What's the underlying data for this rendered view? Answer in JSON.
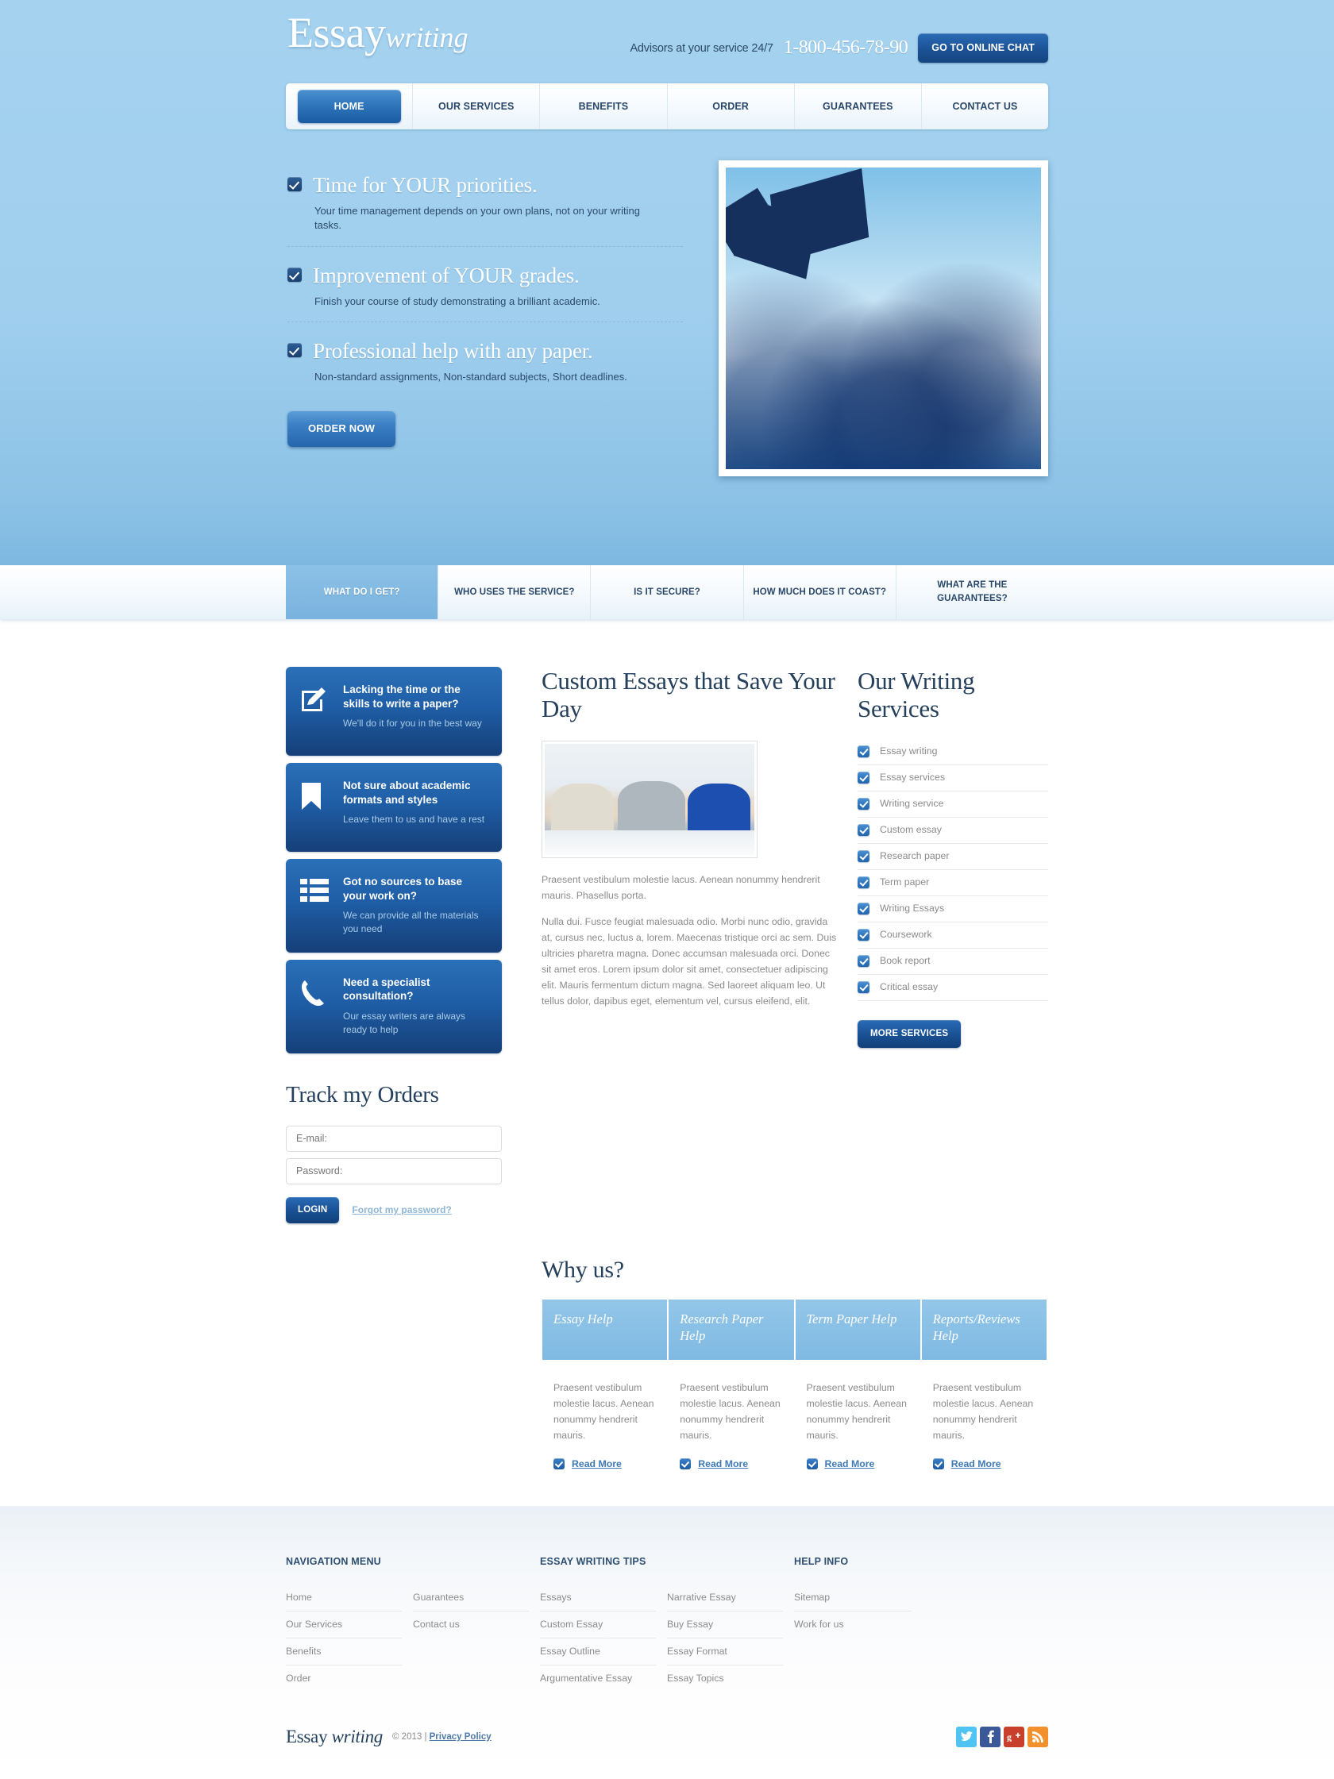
{
  "brand": {
    "name_main": "Essay",
    "name_italic": "writing"
  },
  "header": {
    "advisors_text": "Advisors at your service 24/7",
    "phone": "1-800-456-78-90",
    "chat_button": "GO TO ONLINE CHAT"
  },
  "nav": {
    "items": [
      {
        "label": "HOME",
        "active": true
      },
      {
        "label": "OUR SERVICES",
        "active": false
      },
      {
        "label": "BENEFITS",
        "active": false
      },
      {
        "label": "ORDER",
        "active": false
      },
      {
        "label": "GUARANTEES",
        "active": false
      },
      {
        "label": "CONTACT US",
        "active": false
      }
    ]
  },
  "hero": {
    "features": [
      {
        "title": "Time for YOUR priorities.",
        "desc": "Your time management depends on your own plans, not on your writing tasks."
      },
      {
        "title": "Improvement of YOUR grades.",
        "desc": "Finish your course of study demonstrating a brilliant academic."
      },
      {
        "title": "Professional help with any paper.",
        "desc": "Non-standard assignments, Non-standard subjects, Short deadlines."
      }
    ],
    "order_button": "ORDER NOW"
  },
  "question_tabs": [
    {
      "label": "WHAT DO I GET?",
      "active": true
    },
    {
      "label": "WHO USES THE SERVICE?",
      "active": false
    },
    {
      "label": "IS IT SECURE?",
      "active": false
    },
    {
      "label": "HOW MUCH DOES IT COAST?",
      "active": false
    },
    {
      "label": "WHAT ARE THE GUARANTEES?",
      "active": false
    }
  ],
  "promo_boxes": [
    {
      "icon": "pencil-square-icon",
      "title": "Lacking the time or the skills to write a paper?",
      "desc": "We'll do it for you in the best way"
    },
    {
      "icon": "bookmark-icon",
      "title": "Not sure about academic formats and styles",
      "desc": "Leave them to us and have a rest"
    },
    {
      "icon": "list-icon",
      "title": "Got no sources to base your work on?",
      "desc": "We can provide all the materials you need"
    },
    {
      "icon": "phone-icon",
      "title": "Need a specialist consultation?",
      "desc": "Our essay writers are always ready to help"
    }
  ],
  "track_orders": {
    "heading": "Track my Orders",
    "email_placeholder": "E-mail:",
    "email_value": "",
    "password_placeholder": "Password:",
    "password_value": "",
    "login_button": "LOGIN",
    "forgot_link": "Forgot my password?"
  },
  "main_article": {
    "heading": "Custom Essays that Save Your Day",
    "paragraphs": [
      "Praesent vestibulum molestie lacus. Aenean nonummy hendrerit mauris. Phasellus porta.",
      "Nulla dui. Fusce feugiat malesuada odio. Morbi nunc odio, gravida at, cursus nec, luctus a, lorem. Maecenas tristique orci ac sem. Duis ultricies pharetra magna. Donec accumsan malesuada orci. Donec sit amet eros. Lorem ipsum dolor sit amet, consectetuer adipiscing elit. Mauris fermentum dictum magna. Sed laoreet aliquam leo. Ut tellus dolor, dapibus eget, elementum vel, cursus eleifend, elit."
    ]
  },
  "services": {
    "heading": "Our Writing Services",
    "items": [
      "Essay writing",
      "Essay services",
      "Writing service",
      "Custom essay",
      "Research paper",
      "Term paper",
      "Writing Essays",
      "Coursework",
      "Book report",
      "Critical essay"
    ],
    "more_button": "MORE SERVICES"
  },
  "why_us": {
    "heading": "Why us?",
    "read_more_label": "Read More",
    "columns": [
      {
        "title": "Essay Help",
        "text": "Praesent vestibulum molestie lacus. Aenean nonummy hendrerit mauris."
      },
      {
        "title": "Research Paper Help",
        "text": "Praesent vestibulum molestie lacus. Aenean nonummy hendrerit mauris."
      },
      {
        "title": "Term Paper Help",
        "text": "Praesent vestibulum molestie lacus. Aenean nonummy hendrerit mauris."
      },
      {
        "title": "Reports/Reviews Help",
        "text": "Praesent vestibulum molestie lacus. Aenean nonummy hendrerit mauris."
      }
    ]
  },
  "footer": {
    "groups": [
      {
        "heading": "NAVIGATION MENU",
        "list_a": [
          "Home",
          "Our Services",
          "Benefits",
          "Order"
        ],
        "list_b": [
          "Guarantees",
          "Contact us"
        ]
      },
      {
        "heading": "ESSAY WRITING TIPS",
        "list_a": [
          "Essays",
          "Custom Essay",
          "Essay Outline",
          "Argumentative Essay"
        ],
        "list_b": [
          "Narrative Essay",
          "Buy Essay",
          "Essay Format",
          "Essay Topics"
        ]
      },
      {
        "heading": "HELP INFO",
        "list_a": [
          "Sitemap",
          "Work for us"
        ],
        "list_b": []
      }
    ],
    "copyright": "© 2013  |  ",
    "privacy_link": "Privacy Policy",
    "socials": [
      {
        "name": "twitter-icon",
        "glyph": "t",
        "color": "#4fc4f2"
      },
      {
        "name": "facebook-icon",
        "glyph": "f",
        "color": "#3b5998"
      },
      {
        "name": "google-plus-icon",
        "glyph": "g+",
        "color": "#c8402c"
      },
      {
        "name": "rss-icon",
        "glyph": "◖",
        "color": "#f2902b"
      }
    ]
  },
  "colors": {
    "hero_bg": "#a0cfee",
    "accent_blue": "#1a5296",
    "link_blue": "#3f79b4",
    "text_gray": "#8b8b8b",
    "heading_navy": "#25405c",
    "tab_active": "#7fb9e2"
  }
}
